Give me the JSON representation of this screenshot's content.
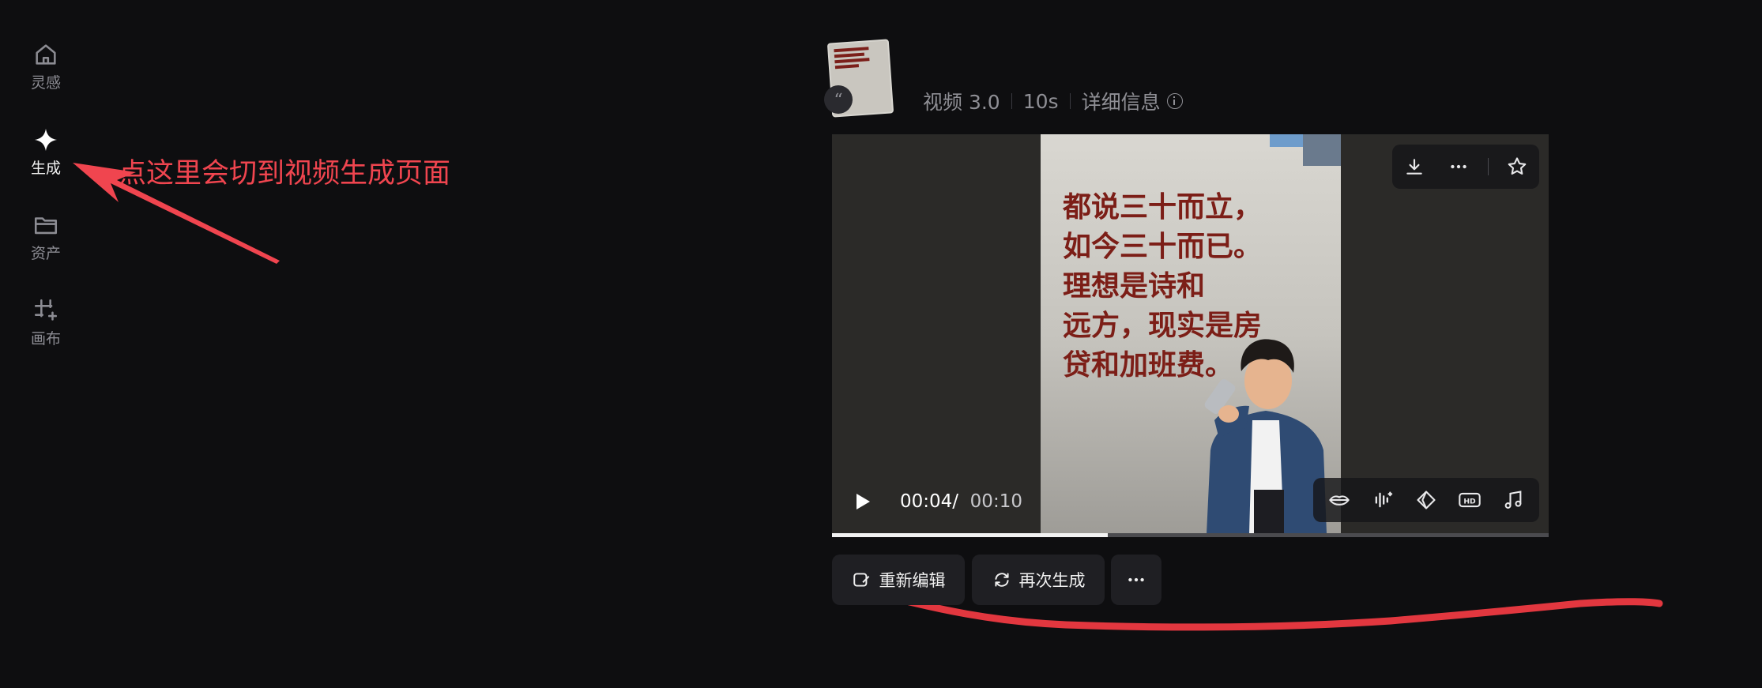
{
  "sidebar": {
    "items": [
      {
        "label": "灵感",
        "icon": "home-icon"
      },
      {
        "label": "生成",
        "icon": "sparkle-icon"
      },
      {
        "label": "资产",
        "icon": "folder-icon"
      },
      {
        "label": "画布",
        "icon": "canvas-icon"
      }
    ]
  },
  "annotation": {
    "text": "点这里会切到视频生成页面",
    "color": "#f0454f"
  },
  "task": {
    "model": "视频 3.0",
    "duration": "10s",
    "details_label": "详细信息"
  },
  "player": {
    "video_text_lines": [
      "都说三十而立，",
      "如今三十而已。",
      "理想是诗和",
      "远方，现实是房",
      "贷和加班费。"
    ],
    "current_time": "00:04",
    "separator": "/",
    "total_time": "00:10",
    "progress": 0.385
  },
  "actions": {
    "reedit": "重新编辑",
    "regenerate": "再次生成"
  },
  "colors": {
    "background": "#0e0e10",
    "annotation": "#f0454f",
    "button": "#1f1f23"
  }
}
